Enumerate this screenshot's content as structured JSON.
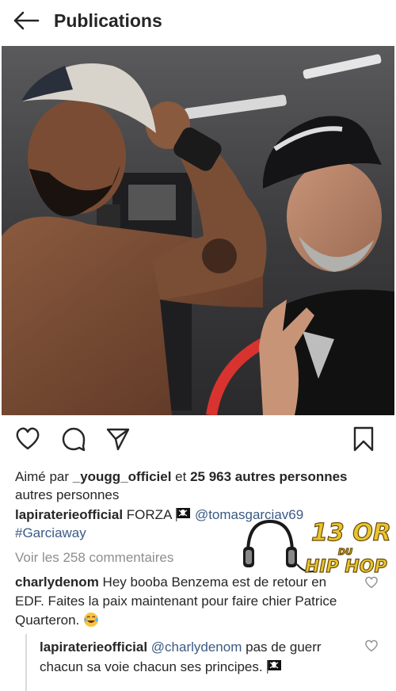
{
  "header": {
    "title": "Publications",
    "back_icon": "arrow-left-icon"
  },
  "post": {
    "photo_alt": "",
    "actions": {
      "like_icon": "heart-outline-icon",
      "comment_icon": "speech-bubble-icon",
      "share_icon": "paper-plane-icon",
      "save_icon": "bookmark-icon"
    },
    "likes": {
      "prefix": "Aimé par ",
      "first_liker": "_yougg_officiel",
      "middle": " et ",
      "count": "25 963 autres personnes",
      "suffix": "autres personnes"
    },
    "caption": {
      "username": "lapiraterieofficial",
      "text": "FORZA",
      "emoji": "pirate-flag",
      "mention": "@tomasgarciav69",
      "hashtag": "#Garciaway"
    },
    "view_comments": "Voir les 258 commentaires",
    "comments": [
      {
        "username": "charlydenom",
        "text": "Hey booba Benzema est de retour en EDF. Faites la paix maintenant pour faire chier Patrice Quarteron.",
        "emoji": "tears-of-joy",
        "replies": [
          {
            "username": "lapiraterieofficial",
            "mention": "@charlydenom",
            "text": "pas de guerr",
            "text_line2": "chacun sa voie chacun ses principes.",
            "emoji": "pirate-flag"
          }
        ]
      }
    ]
  },
  "watermark": {
    "line1": "13 OR",
    "line2": "DU",
    "line3": "HIP HOP",
    "icon": "headphones-icon"
  },
  "colors": {
    "text": "#262626",
    "link": "#3b5a85",
    "muted": "#8e8e8e",
    "watermark_gold": "#e8c530"
  }
}
